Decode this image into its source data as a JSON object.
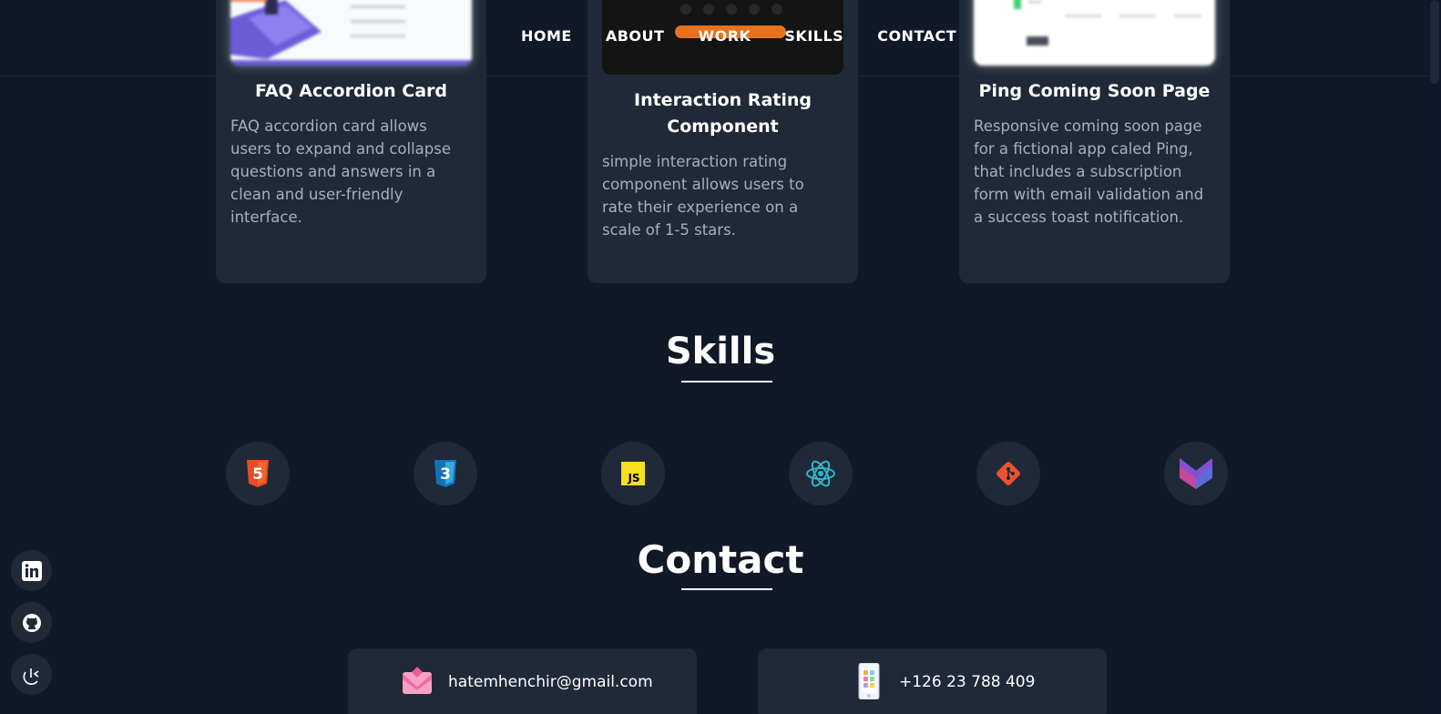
{
  "nav": {
    "items": [
      "HOME",
      "ABOUT",
      "WORK",
      "SKILLS",
      "CONTACT"
    ]
  },
  "projects": [
    {
      "title": "FAQ Accordion Card",
      "description": [
        "FAQ accordion card allows",
        "users to expand and collapse",
        "questions and answers in a",
        "clean and user-friendly",
        "interface."
      ]
    },
    {
      "title": [
        "Interaction Rating",
        "Component"
      ],
      "description": [
        "simple interaction rating",
        "component allows users to",
        "rate their experience on a",
        "scale of 1-5 stars."
      ]
    },
    {
      "title": "Ping Coming Soon Page",
      "description": [
        "Responsive coming soon page",
        "for a fictional app caled Ping,",
        "that includes a subscription",
        "form with email validation and",
        "a success toast notification."
      ]
    }
  ],
  "skills": {
    "title": "Skills",
    "items": [
      {
        "icon": "html5-icon",
        "label": "5",
        "color": "#e44d26"
      },
      {
        "icon": "css3-icon",
        "label": "3",
        "color": "#1572b6"
      },
      {
        "icon": "javascript-icon",
        "label": "JS",
        "color": "#f7df1e"
      },
      {
        "icon": "react-icon",
        "color": "#2fb5c9"
      },
      {
        "icon": "git-icon",
        "color": "#f05032"
      },
      {
        "icon": "mui-icon",
        "color": "#7b4fd8"
      }
    ]
  },
  "contact": {
    "title": "Contact",
    "email": "hatemhenchir@gmail.com",
    "phone": "+126 23 788 409"
  },
  "social": [
    {
      "icon": "linkedin-icon"
    },
    {
      "icon": "github-icon"
    },
    {
      "icon": "codepen-icon"
    }
  ],
  "colors": {
    "background": "#111827",
    "card": "#1f2937",
    "muted_text": "#a8b0bd",
    "accent_orange": "#e8711c"
  }
}
